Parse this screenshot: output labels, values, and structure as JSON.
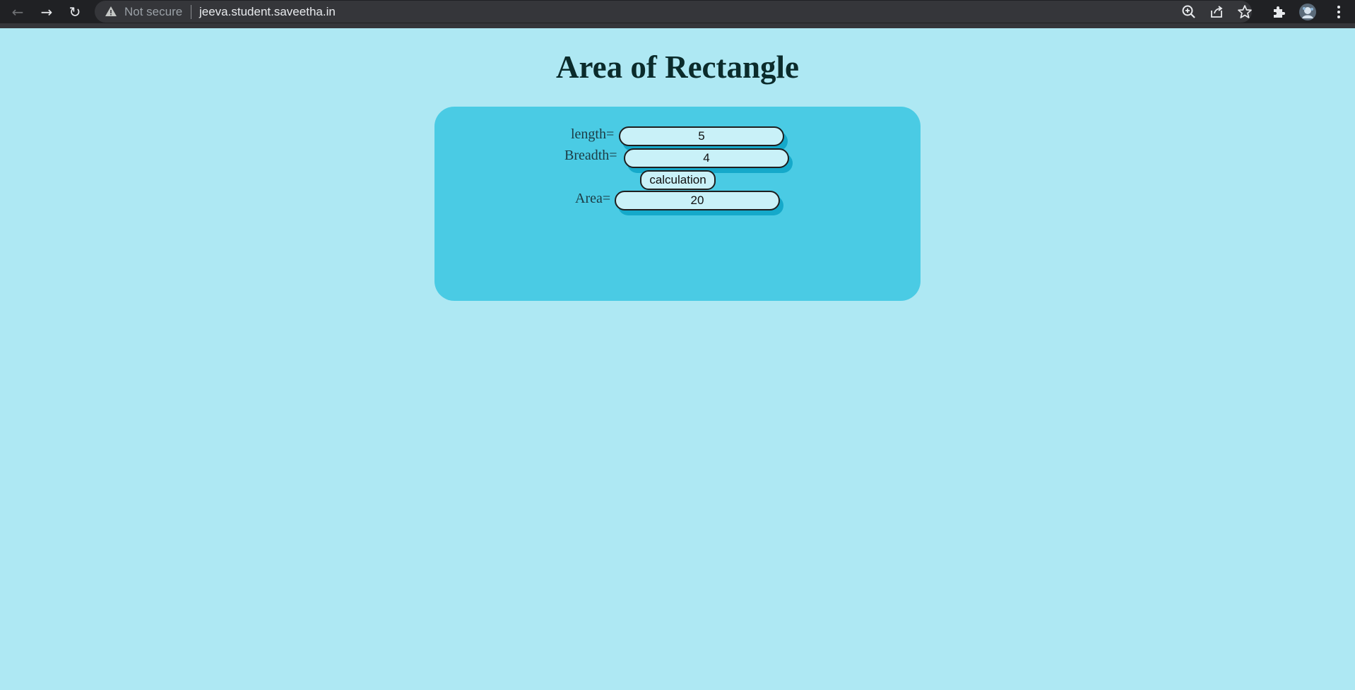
{
  "browser": {
    "security_label": "Not secure",
    "url": "jeeva.student.saveetha.in",
    "icons": {
      "back": "arrow-left-icon",
      "forward": "arrow-right-icon",
      "reload": "reload-icon",
      "warning": "warning-triangle-icon",
      "zoom": "zoom-icon",
      "share": "share-icon",
      "bookmark": "star-icon",
      "extensions": "puzzle-icon",
      "profile": "avatar-icon",
      "menu": "kebab-menu-icon"
    }
  },
  "page": {
    "title": "Area of Rectangle",
    "form": {
      "length_label": "length=",
      "length_value": "5",
      "breadth_label": "Breadth=",
      "breadth_value": "4",
      "button_label": "calculation",
      "area_label": "Area=",
      "area_value": "20"
    }
  },
  "colors": {
    "page_background": "#aee8f3",
    "card_background": "#4acbe4",
    "field_background": "#c9f1f8",
    "field_shadow": "#15a9ca"
  }
}
